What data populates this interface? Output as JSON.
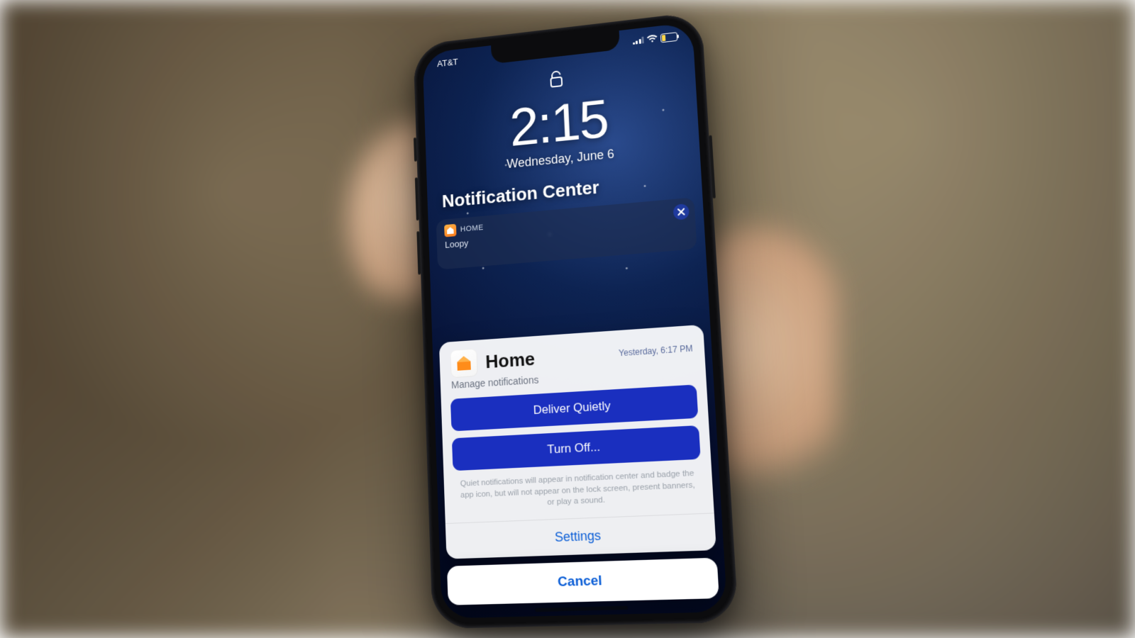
{
  "status": {
    "carrier": "AT&T"
  },
  "lock": {
    "time": "2:15",
    "date": "Wednesday, June 6"
  },
  "nc": {
    "title": "Notification Center"
  },
  "bg_notif": {
    "app_label": "HOME",
    "subject": "Loopy"
  },
  "sheet": {
    "app_name": "Home",
    "timestamp": "Yesterday, 6:17 PM",
    "subtitle": "Manage notifications",
    "deliver_quietly": "Deliver Quietly",
    "turn_off": "Turn Off...",
    "help_text": "Quiet notifications will appear in notification center and badge the app icon, but will not appear on the lock screen, present banners, or play a sound.",
    "settings": "Settings",
    "cancel": "Cancel"
  },
  "colors": {
    "action_blue": "#1a2fbf",
    "link_blue": "#0a5dd6"
  }
}
